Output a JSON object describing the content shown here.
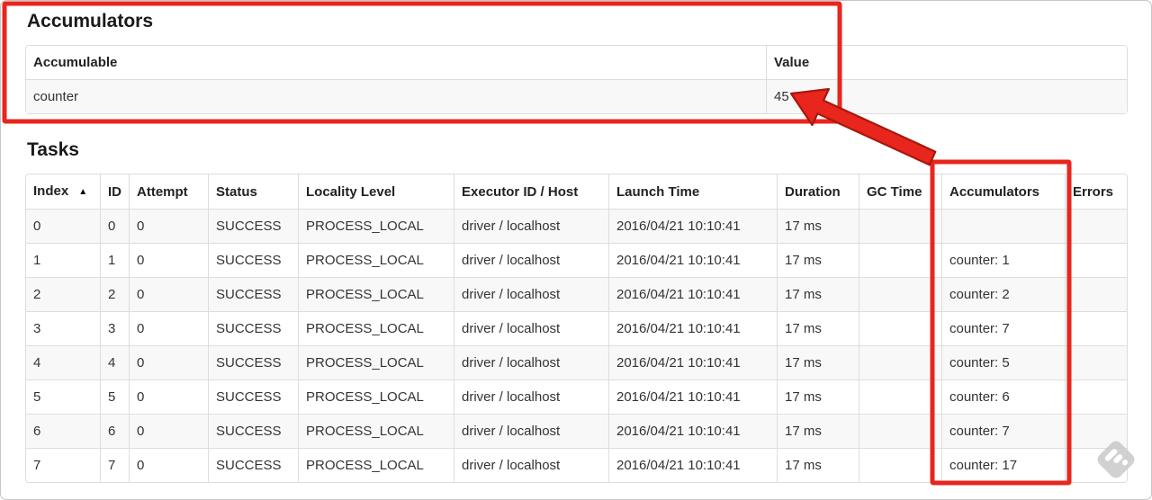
{
  "accumulators_section": {
    "title": "Accumulators",
    "table": {
      "headers": [
        "Accumulable",
        "Value"
      ],
      "rows": [
        {
          "accumulable": "counter",
          "value": "45"
        }
      ]
    }
  },
  "tasks_section": {
    "title": "Tasks",
    "table": {
      "sorted_by": "Index",
      "sort_direction": "ascending",
      "sort_icon": "▲",
      "columns": [
        {
          "key": "index",
          "label": "Index"
        },
        {
          "key": "id",
          "label": "ID"
        },
        {
          "key": "attempt",
          "label": "Attempt"
        },
        {
          "key": "status",
          "label": "Status"
        },
        {
          "key": "locality-level",
          "label": "Locality Level"
        },
        {
          "key": "executor-id-host",
          "label": "Executor ID / Host"
        },
        {
          "key": "launch-time",
          "label": "Launch Time"
        },
        {
          "key": "duration",
          "label": "Duration"
        },
        {
          "key": "gc-time",
          "label": "GC Time"
        },
        {
          "key": "accumulators",
          "label": "Accumulators"
        },
        {
          "key": "errors",
          "label": "Errors"
        }
      ],
      "rows": [
        [
          "0",
          "0",
          "0",
          "SUCCESS",
          "PROCESS_LOCAL",
          "driver / localhost",
          "2016/04/21 10:10:41",
          "17 ms",
          "",
          "",
          ""
        ],
        [
          "1",
          "1",
          "0",
          "SUCCESS",
          "PROCESS_LOCAL",
          "driver / localhost",
          "2016/04/21 10:10:41",
          "17 ms",
          "",
          "counter: 1",
          ""
        ],
        [
          "2",
          "2",
          "0",
          "SUCCESS",
          "PROCESS_LOCAL",
          "driver / localhost",
          "2016/04/21 10:10:41",
          "17 ms",
          "",
          "counter: 2",
          ""
        ],
        [
          "3",
          "3",
          "0",
          "SUCCESS",
          "PROCESS_LOCAL",
          "driver / localhost",
          "2016/04/21 10:10:41",
          "17 ms",
          "",
          "counter: 7",
          ""
        ],
        [
          "4",
          "4",
          "0",
          "SUCCESS",
          "PROCESS_LOCAL",
          "driver / localhost",
          "2016/04/21 10:10:41",
          "17 ms",
          "",
          "counter: 5",
          ""
        ],
        [
          "5",
          "5",
          "0",
          "SUCCESS",
          "PROCESS_LOCAL",
          "driver / localhost",
          "2016/04/21 10:10:41",
          "17 ms",
          "",
          "counter: 6",
          ""
        ],
        [
          "6",
          "6",
          "0",
          "SUCCESS",
          "PROCESS_LOCAL",
          "driver / localhost",
          "2016/04/21 10:10:41",
          "17 ms",
          "",
          "counter: 7",
          ""
        ],
        [
          "7",
          "7",
          "0",
          "SUCCESS",
          "PROCESS_LOCAL",
          "driver / localhost",
          "2016/04/21 10:10:41",
          "17 ms",
          "",
          "counter: 17",
          ""
        ]
      ]
    }
  },
  "annotations": {
    "color": "#e8261d",
    "arrow_outline": "#a8170b",
    "watermark_color": "#c9c9c9"
  }
}
